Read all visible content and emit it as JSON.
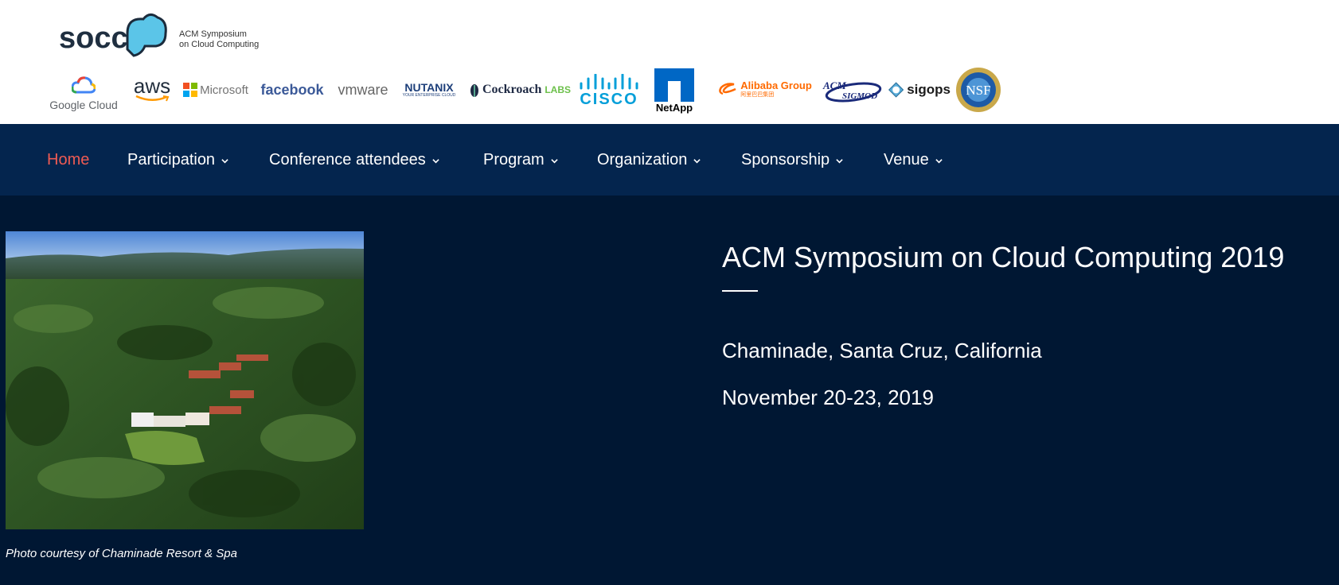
{
  "header": {
    "logo_name": "socc",
    "tagline_line1": "ACM Symposium",
    "tagline_line2": "on Cloud Computing",
    "sponsors": {
      "google": "Google Cloud",
      "aws": "aws",
      "microsoft": "Microsoft",
      "facebook": "facebook",
      "vmware": "vmware",
      "nutanix": "NUTANIX",
      "nutanix_sub": "YOUR ENTERPRISE CLOUD",
      "cockroach": "Cockroach",
      "cockroach_labs": "LABS",
      "cisco": "CISCO",
      "netapp": "NetApp",
      "alibaba": "Alibaba Group",
      "alibaba_sub": "阿里巴巴集团",
      "acm": "ACM",
      "sigmod": "SIGMOD",
      "sigops": "sigops",
      "nsf": "NSF"
    }
  },
  "nav": {
    "items": [
      {
        "label": "Home"
      },
      {
        "label": "Participation"
      },
      {
        "label": "Conference attendees"
      },
      {
        "label": "Program"
      },
      {
        "label": "Organization"
      },
      {
        "label": "Sponsorship"
      },
      {
        "label": "Venue"
      }
    ]
  },
  "main": {
    "caption": "Photo courtesy of Chaminade Resort & Spa",
    "title": "ACM Symposium on Cloud Computing 2019",
    "location": "Chaminade, Santa Cruz, California",
    "dates": "November 20-23, 2019"
  },
  "colors": {
    "nav_bg": "#04254e",
    "page_bg": "#001733",
    "active_nav": "#ef5b53",
    "cloud_accent": "#5bc5e8"
  }
}
